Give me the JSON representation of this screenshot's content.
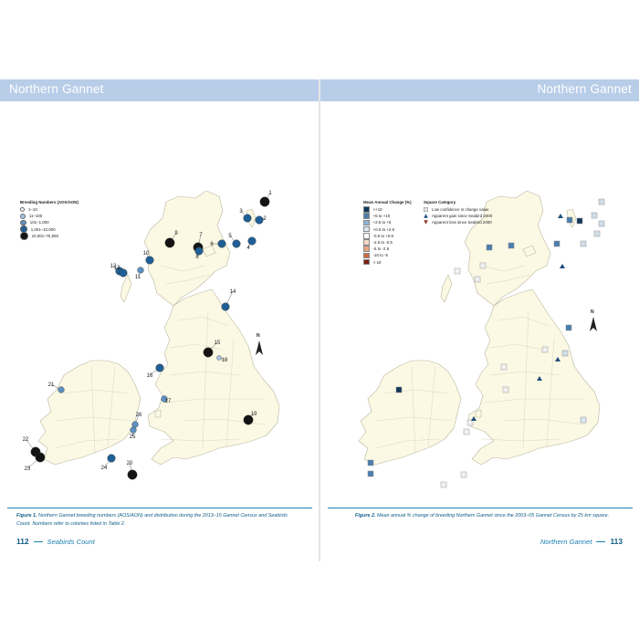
{
  "header": {
    "left_title": "Northern Gannet",
    "right_title": "Northern Gannet"
  },
  "left_legend": {
    "title": "Breeding Numbers (AOS/AON)",
    "items": [
      {
        "label": "1–10",
        "color": "#ffffff"
      },
      {
        "label": "11–100",
        "color": "#a8c6e4"
      },
      {
        "label": "101–1,000",
        "color": "#5c8fbf"
      },
      {
        "label": "1,001–10,000",
        "color": "#1f5f95"
      },
      {
        "label": "10,001–75,500",
        "color": "#141414"
      }
    ]
  },
  "right_legend_change": {
    "title": "Mean Annual Change (%)",
    "items": [
      {
        "label": ">+10",
        "color": "#13385a"
      },
      {
        "label": "+5 to +10",
        "color": "#4a7fae"
      },
      {
        "label": "+2.5 to +5",
        "color": "#8fb5d8"
      },
      {
        "label": "+0.5 to +2.5",
        "color": "#d9e8f4"
      },
      {
        "label": "-0.5 to +0.5",
        "color": "#ffffff"
      },
      {
        "label": "-2.5 to -0.5",
        "color": "#f4d6c6"
      },
      {
        "label": "-5 to -2.5",
        "color": "#e7a583"
      },
      {
        "label": "-10 to -5",
        "color": "#d06a3e"
      },
      {
        "label": "<-10",
        "color": "#7a1d12"
      }
    ]
  },
  "right_legend_category": {
    "title": "Square Category",
    "items": [
      {
        "label": "Low confidence in change value",
        "icon": "boxed-square-icon"
      },
      {
        "label": "Apparent gain since Seabird 2000",
        "icon": "triangle-up-icon"
      },
      {
        "label": "Apparent loss since Seabird 2000",
        "icon": "triangle-down-icon"
      }
    ]
  },
  "colony_numbers": [
    "1",
    "2",
    "3",
    "4",
    "5",
    "6",
    "7",
    "8",
    "9",
    "10",
    "11",
    "12",
    "13",
    "14",
    "15",
    "16",
    "17",
    "18",
    "19",
    "20",
    "21",
    "22",
    "23",
    "24",
    "25",
    "26",
    "27",
    "28"
  ],
  "north_label": "N",
  "figure1_caption": {
    "label": "Figure 1.",
    "text": "Northern Gannet breeding numbers (AOS/AON) and distribution during the 2013–15 Gannet Census and Seabirds Count. Numbers refer to colonies listed in Table 2."
  },
  "figure2_caption": {
    "label": "Figure 2.",
    "text": "Mean annual % change of breeding Northern Gannet since the 2003–05 Gannet Census by 25 km square."
  },
  "footer": {
    "left_page_number": "112",
    "left_running_title": "Seabirds Count",
    "right_running_title": "Northern Gannet",
    "right_page_number": "113"
  }
}
